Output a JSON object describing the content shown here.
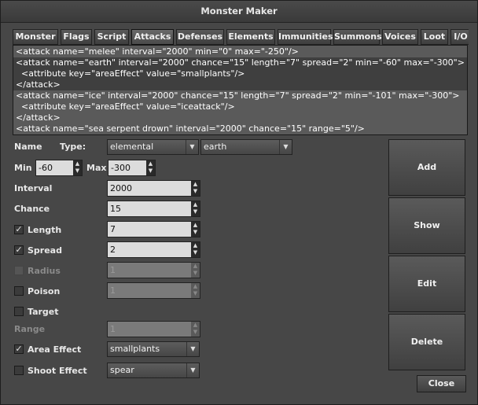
{
  "window": {
    "title": "Monster Maker"
  },
  "tabs": [
    "Monster",
    "Flags",
    "Script",
    "Attacks",
    "Defenses",
    "Elements",
    "Immunities",
    "Summons",
    "Voices",
    "Loot",
    "I/O"
  ],
  "active_tab": "Attacks",
  "attack_list": [
    "<attack name=\"melee\" interval=\"2000\" min=\"0\" max=\"-250\"/>",
    "<attack name=\"earth\" interval=\"2000\" chance=\"15\" length=\"7\" spread=\"2\" min=\"-60\" max=\"-300\">",
    "  <attribute key=\"areaEffect\" value=\"smallplants\"/>",
    "</attack>",
    "<attack name=\"ice\" interval=\"2000\" chance=\"15\" length=\"7\" spread=\"2\" min=\"-101\" max=\"-300\">",
    "  <attribute key=\"areaEffect\" value=\"iceattack\"/>",
    "</attack>",
    "<attack name=\"sea serpent drown\" interval=\"2000\" chance=\"15\" range=\"5\"/>"
  ],
  "form": {
    "name_label": "Name",
    "type_label": "Type:",
    "type_value": "elemental",
    "subtype_value": "earth",
    "min_label": "Min",
    "min_value": "-60",
    "max_label": "Max",
    "max_value": "-300",
    "interval_label": "Interval",
    "interval_value": "2000",
    "chance_label": "Chance",
    "chance_value": "15",
    "length_label": "Length",
    "length_value": "7",
    "spread_label": "Spread",
    "spread_value": "2",
    "radius_label": "Radius",
    "radius_value": "1",
    "poison_label": "Poison",
    "poison_value": "1",
    "target_label": "Target",
    "range_label": "Range",
    "range_value": "1",
    "area_effect_label": "Area Effect",
    "area_effect_value": "smallplants",
    "shoot_effect_label": "Shoot Effect",
    "shoot_effect_value": "spear"
  },
  "checks": {
    "length": true,
    "spread": true,
    "radius": false,
    "poison": false,
    "target": false,
    "area_effect": true,
    "shoot_effect": false
  },
  "check_glyph": "✓",
  "buttons": {
    "add": "Add",
    "show": "Show",
    "edit": "Edit",
    "delete": "Delete",
    "close": "Close"
  },
  "glyphs": {
    "down": "▼",
    "up": "▲"
  }
}
